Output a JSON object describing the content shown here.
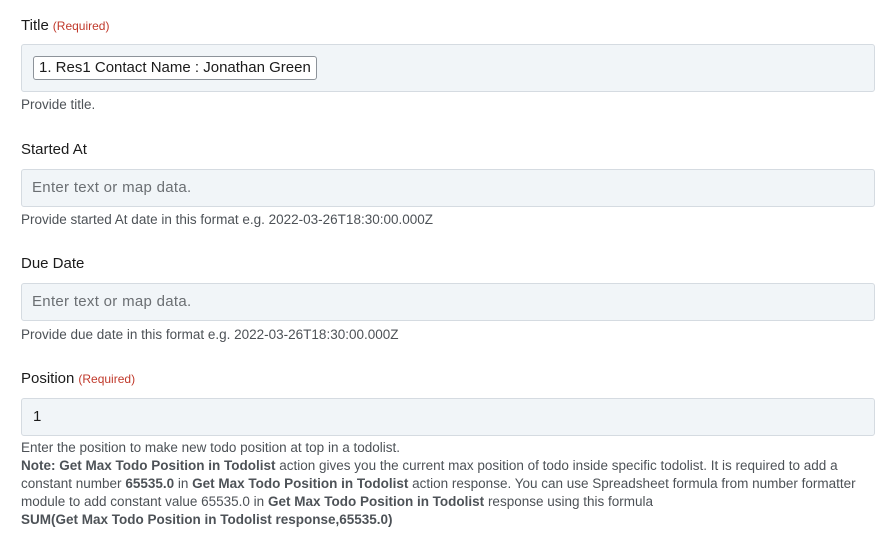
{
  "title_field": {
    "label": "Title",
    "required": "(Required)",
    "mapped_value": "1. Res1 Contact Name : Jonathan Green",
    "help": "Provide title."
  },
  "started_at_field": {
    "label": "Started At",
    "placeholder": "Enter text or map data.",
    "help": "Provide started At date in this format e.g. 2022-03-26T18:30:00.000Z"
  },
  "due_date_field": {
    "label": "Due Date",
    "placeholder": "Enter text or map data.",
    "help": "Provide due date in this format e.g. 2022-03-26T18:30:00.000Z"
  },
  "position_field": {
    "label": "Position",
    "required": "(Required)",
    "value": "1",
    "help_line1": "Enter the position to make new todo position at top in a todolist.",
    "note_label": "Note:",
    "note_action": "Get Max Todo Position in Todolist",
    "note_text1": " action gives you the current max position of todo inside specific todolist. It is required to add a constant number ",
    "note_constant": "65535.0",
    "note_in": " in ",
    "note_action2": "Get Max Todo Position in Todolist",
    "note_text2": " action response. You can use Spreadsheet formula from number formatter module to add constant value 65535.0 in ",
    "note_action3": "Get Max Todo Position in Todolist",
    "note_text3": " response using this formula ",
    "note_formula": "SUM(Get Max Todo Position in Todolist response,65535.0)"
  }
}
